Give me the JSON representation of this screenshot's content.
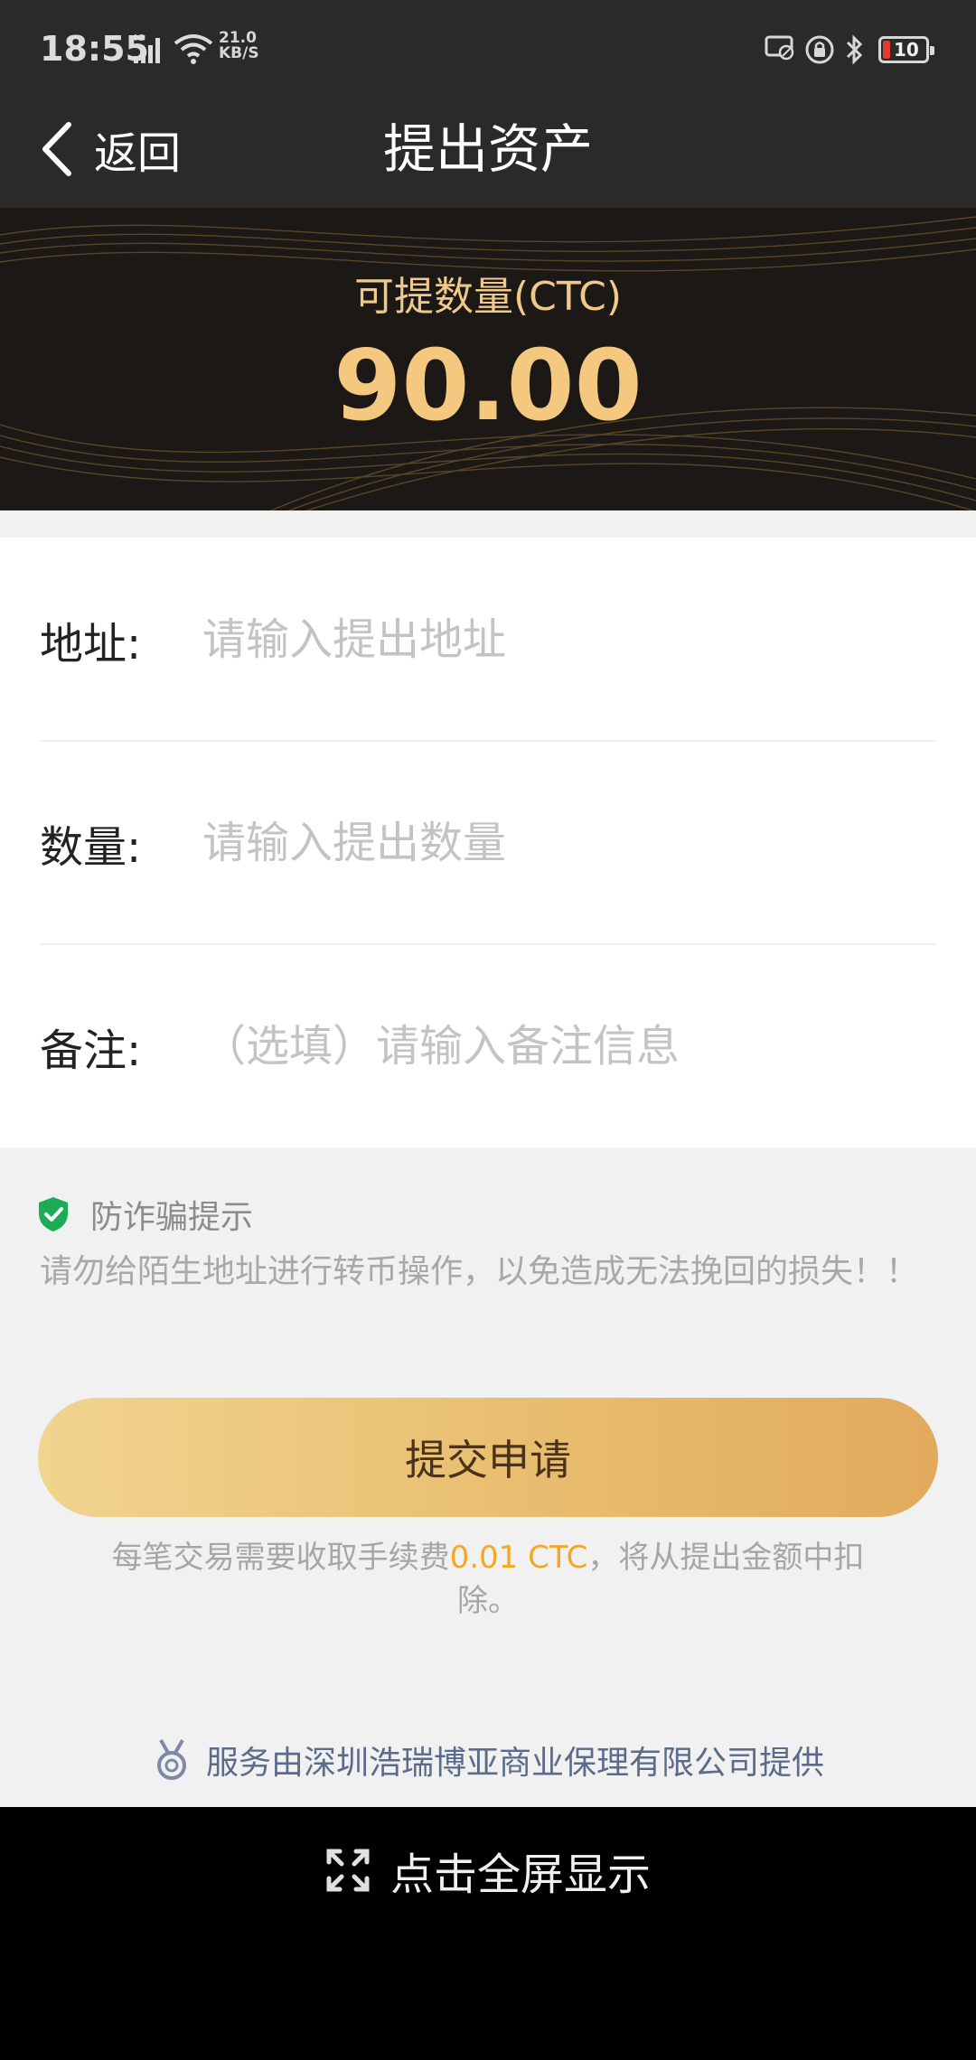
{
  "status": {
    "time": "18:55",
    "network": "4G",
    "speed_value": "21.0",
    "speed_unit": "KB/S",
    "battery": "10"
  },
  "header": {
    "back_label": "返回",
    "title": "提出资产"
  },
  "banner": {
    "label": "可提数量(CTC)",
    "amount": "90.00"
  },
  "form": {
    "address": {
      "label": "地址:",
      "placeholder": "请输入提出地址",
      "value": ""
    },
    "quantity": {
      "label": "数量:",
      "placeholder": "请输入提出数量",
      "value": ""
    },
    "note": {
      "label": "备注:",
      "placeholder": "（选填）请输入备注信息",
      "value": ""
    }
  },
  "warning": {
    "title": "防诈骗提示",
    "text": "请勿给陌生地址进行转币操作，以免造成无法挽回的损失！！"
  },
  "submit_label": "提交申请",
  "fee": {
    "prefix": "每笔交易需要收取手续费",
    "amount": "0.01 CTC",
    "suffix": "，将从提出金额中扣除。"
  },
  "provider": "服务由深圳浩瑞博亚商业保理有限公司提供",
  "fullscreen_label": "点击全屏显示",
  "colors": {
    "accent_gold": "#f4c87e",
    "fee_highlight": "#f5a623",
    "shield_green": "#1aad55",
    "battery_low": "#e23a2e"
  }
}
